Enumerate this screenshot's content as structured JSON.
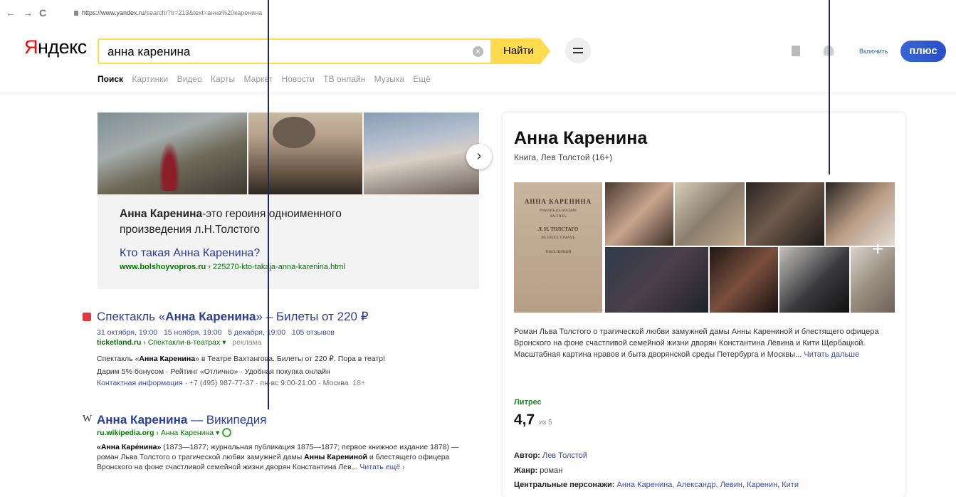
{
  "browser": {
    "back": "←",
    "forward": "→",
    "reload": "C",
    "url_host": "https://www.yandex.ru",
    "url_rest": "/search/?lr=213&text=анна%20каренина"
  },
  "header": {
    "logo_first": "Я",
    "logo_rest": "ндекс",
    "search_value": "анна каренина",
    "clear_glyph": "×",
    "find_label": "Найти",
    "enable_label": "Включить",
    "plus_label": "плюс"
  },
  "tabs": [
    "Поиск",
    "Картинки",
    "Видео",
    "Карты",
    "Маркет",
    "Новости",
    "ТВ онлайн",
    "Музыка",
    "Ещё"
  ],
  "image_card": {
    "next": "›",
    "desc_bold": "Анна Каренина",
    "desc_rest": "-это героиня одноименного произведения л.Н.Толстого",
    "link": "Кто такая Анна Каренина?",
    "url_bold": "www.bolshoyvopros.ru",
    "url_rest": " › 225270-kto-takaja-anna-karenina.html"
  },
  "result1": {
    "title_pre": "Спектакль «",
    "title_bold": "Анна Каренина",
    "title_post": "» – Билеты от 220 ₽",
    "dates": [
      "31 октября, 19:00",
      "15 ноября, 19:00",
      "5 декабря, 19:00",
      "105 отзывов"
    ],
    "domain": "ticketland.ru",
    "path": " › Спектакли-в-театрах ▾",
    "ad": "реклама",
    "line1_pre": "Спектакль «",
    "line1_bold": "Анна Каренина",
    "line1_post": "» в Театре Вахтангова. Билеты от 220 ₽. Пора в театр!",
    "line2": "Дарим 5% бонусом · Рейтинг «Отлично» · Удобная покупка онлайн",
    "contacts": "Контактная информация",
    "contacts_rest": " · +7 (495) 987-77-37 · пн-вс 9:00-21:00 · Москва",
    "contacts_tail": "18+"
  },
  "result2": {
    "icon": "W",
    "title_bold": "Анна Каренина",
    "title_rest": " — Википедия",
    "domain": "ru.wikipedia.org",
    "path": " › Анна Каренина ▾",
    "s1_bold": "«Анна Каре́нина»",
    "s1_rest": " (1873—1877; журнальная публикация 1875—1877; первое книжное издание 1878) — роман Льва Толстого о трагической любви замужней дамы ",
    "s2_bold": "Анны Карениной",
    "s2_rest": " и блестящего офицера Вронского на фоне счастливой семейной жизни дворян Константина Лев... ",
    "more": "Читать ещё ›"
  },
  "knowledge": {
    "title": "Анна Каренина",
    "subtitle": "Книга, Лев Толстой (16+)",
    "book_cover": [
      "АННА КАРЕНИНА",
      "РОМАНЪ ВЪ ВОСЬМИ",
      "ЧАСТЯХЪ",
      "Л. Н. ТОЛСТАГО",
      "ВЪ ТРЕХЪ ТОМАХЪ",
      "ТОМЪ ПЕРВЫЙ"
    ],
    "gallery_plus": "+",
    "desc": "Роман Льва Толстого о трагической любви замужней дамы Анны Карениной и блестящего офицера Вронского на фоне счастливой семейной жизни дворян Константина Лёвина и Кити Щербацкой. Масштабная картина нравов и быта дворянской среды Петербурга и Москвы... ",
    "more": "Читать дальше",
    "source": "Литрес",
    "rating_value": "4,7",
    "rating_of": "из 5",
    "author_label": "Автор:",
    "author": "Лев Толстой",
    "genre_label": "Жанр:",
    "genre": "роман",
    "chars_label": "Центральные персонажи:",
    "chars": "Анна Каренина, Александр, Левин, Каренин, Кити"
  },
  "colors": {
    "accent_yellow": "#ffdb4d",
    "logo_red": "#ff0000",
    "link_blue": "#2a3d9a",
    "url_green": "#007700",
    "overlay_line": "#1f2a57"
  }
}
